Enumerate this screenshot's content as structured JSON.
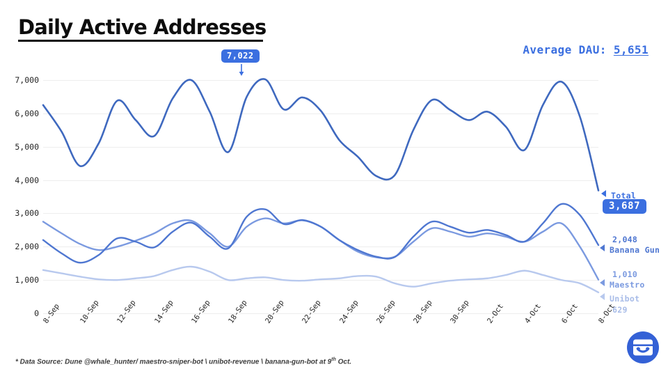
{
  "header": {
    "title": "Daily Active Addresses",
    "average_dau_label": "Average DAU:",
    "average_dau_value": "5,651"
  },
  "annotation": {
    "peak_label": "7,022"
  },
  "footnote": {
    "text_before": "* Data Source: Dune @whale_hunter/ maestro-sniper-bot \\ unibot-revenue \\ banana-gun-bot at 9",
    "sup": "th",
    "text_after": " Oct."
  },
  "legend": {
    "total": {
      "label": "Total",
      "value": "3,687",
      "marker": "left-triangle-icon"
    },
    "banana_gun": {
      "label": "Banana Gun",
      "value": "2,048",
      "marker": "left-triangle-icon"
    },
    "maestro": {
      "label": "Maestro",
      "value": "1,010",
      "marker": "left-triangle-icon"
    },
    "unibot": {
      "label": "Unibot",
      "value": "629",
      "marker": "left-triangle-icon"
    }
  },
  "logo": {
    "name": "bot-face-logo",
    "color": "#3461d6"
  },
  "colors": {
    "accent": "#3b6fe0",
    "total": "#3f69bf",
    "banana_gun": "#4f77d1",
    "maestro": "#7b9ae0",
    "unibot": "#b8c9ee",
    "grid": "#ededed",
    "text": "#262626"
  },
  "chart_data": {
    "type": "line",
    "title": "Daily Active Addresses",
    "xlabel": "",
    "ylabel": "",
    "ylim": [
      0,
      7400
    ],
    "yticks": [
      0,
      1000,
      2000,
      3000,
      4000,
      5000,
      6000,
      7000
    ],
    "ytick_labels": [
      "0",
      "1,000",
      "2,000",
      "3,000",
      "4,000",
      "5,000",
      "6,000",
      "7,000"
    ],
    "grid": true,
    "legend_position": "right-inline",
    "annotations": [
      {
        "text": "7,022",
        "series": "Total",
        "x": "18-Sep",
        "y": 7022
      },
      {
        "text": "Average DAU: 5,651",
        "value": 5651
      }
    ],
    "x": [
      "8-Sep",
      "9-Sep",
      "10-Sep",
      "11-Sep",
      "12-Sep",
      "13-Sep",
      "14-Sep",
      "15-Sep",
      "16-Sep",
      "17-Sep",
      "18-Sep",
      "19-Sep",
      "20-Sep",
      "21-Sep",
      "22-Sep",
      "23-Sep",
      "24-Sep",
      "25-Sep",
      "26-Sep",
      "27-Sep",
      "28-Sep",
      "29-Sep",
      "30-Sep",
      "1-Oct",
      "2-Oct",
      "3-Oct",
      "4-Oct",
      "5-Oct",
      "6-Oct",
      "7-Oct",
      "8-Oct"
    ],
    "xtick_labels": [
      "8-Sep",
      "10-Sep",
      "12-Sep",
      "14-Sep",
      "16-Sep",
      "18-Sep",
      "20-Sep",
      "22-Sep",
      "24-Sep",
      "26-Sep",
      "28-Sep",
      "30-Sep",
      "2-Oct",
      "4-Oct",
      "6-Oct",
      "8-Oct"
    ],
    "series": [
      {
        "name": "Total",
        "color": "#3f69bf",
        "end_value": 3687,
        "values": [
          6250,
          5450,
          4420,
          5100,
          6380,
          5800,
          5320,
          6450,
          7000,
          6050,
          4840,
          6500,
          7022,
          6120,
          6480,
          6080,
          5200,
          4700,
          4120,
          4150,
          5500,
          6400,
          6100,
          5800,
          6050,
          5600,
          4900,
          6250,
          6950,
          5900,
          3687
        ]
      },
      {
        "name": "Banana Gun",
        "color": "#4f77d1",
        "end_value": 2048,
        "values": [
          2200,
          1800,
          1520,
          1750,
          2250,
          2150,
          1980,
          2450,
          2720,
          2300,
          1950,
          2900,
          3120,
          2680,
          2800,
          2600,
          2200,
          1900,
          1700,
          1690,
          2300,
          2750,
          2600,
          2420,
          2500,
          2350,
          2150,
          2700,
          3280,
          2950,
          2048
        ]
      },
      {
        "name": "Maestro",
        "color": "#7b9ae0",
        "end_value": 1010,
        "values": [
          2750,
          2400,
          2080,
          1900,
          2000,
          2180,
          2400,
          2700,
          2780,
          2400,
          2000,
          2600,
          2850,
          2700,
          2790,
          2600,
          2200,
          1850,
          1680,
          1700,
          2150,
          2550,
          2450,
          2300,
          2400,
          2300,
          2150,
          2450,
          2700,
          2000,
          1010
        ]
      },
      {
        "name": "Unibot",
        "color": "#b8c9ee",
        "end_value": 629,
        "values": [
          1300,
          1200,
          1100,
          1020,
          1000,
          1050,
          1120,
          1300,
          1400,
          1250,
          1000,
          1050,
          1080,
          1000,
          980,
          1020,
          1050,
          1120,
          1100,
          900,
          800,
          900,
          980,
          1020,
          1050,
          1150,
          1280,
          1150,
          1000,
          900,
          629
        ]
      }
    ]
  }
}
